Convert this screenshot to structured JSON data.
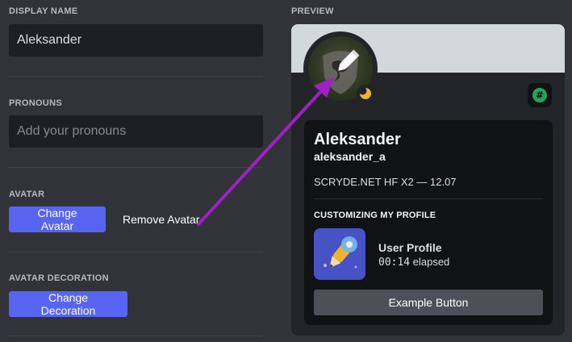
{
  "form": {
    "display_name_label": "DISPLAY NAME",
    "display_name_value": "Aleksander",
    "pronouns_label": "PRONOUNS",
    "pronouns_placeholder": "Add your pronouns",
    "avatar_label": "AVATAR",
    "change_avatar_label": "Change Avatar",
    "remove_avatar_label": "Remove Avatar",
    "decoration_label": "AVATAR DECORATION",
    "change_decoration_label": "Change Decoration"
  },
  "preview": {
    "label": "PREVIEW",
    "display_name": "Aleksander",
    "username": "aleksander_a",
    "custom_status": "SCRYDE.NET HF X2 — 12.07",
    "activity_heading": "CUSTOMIZING MY PROFILE",
    "activity_name": "User Profile",
    "activity_time": "00:14",
    "activity_elapsed_suffix": " elapsed",
    "example_button": "Example Button",
    "badge_glyph": "#"
  },
  "icons": {
    "status": "moon-icon",
    "badge": "hash-badge-icon",
    "avatar_edit": "pencil-icon"
  },
  "colors": {
    "background": "#313338",
    "input_bg": "#1e1f22",
    "brand": "#5865f2",
    "banner": "#d3d9db",
    "card": "#232428",
    "inner_card": "#111214",
    "secondary_button": "#4e5058",
    "annotation_arrow": "#a020c8",
    "idle_status": "#f0b232",
    "badge_green": "#23a55a"
  }
}
